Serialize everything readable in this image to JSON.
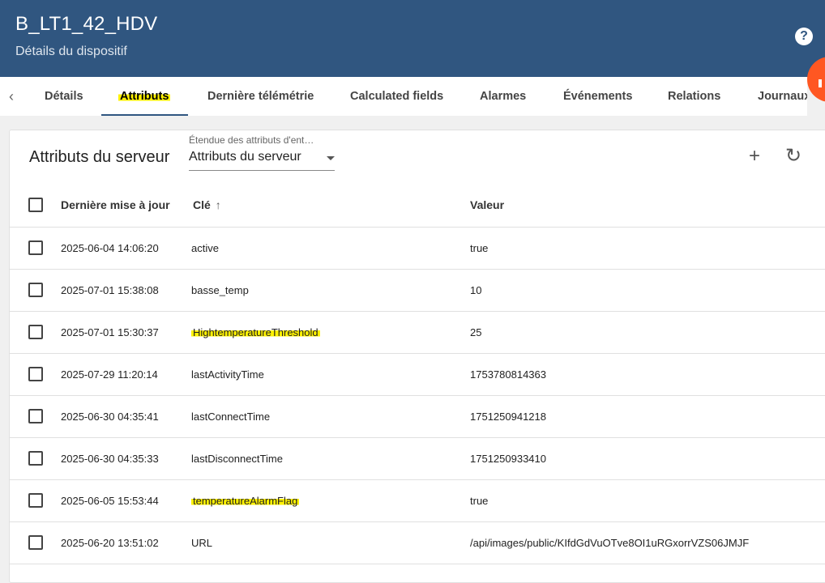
{
  "header": {
    "title": "B_LT1_42_HDV",
    "subtitle": "Détails du dispositif",
    "help_glyph": "?"
  },
  "tabs": [
    {
      "label": "Détails"
    },
    {
      "label": "Attributs",
      "active": true,
      "highlighted": true
    },
    {
      "label": "Dernière télémétrie"
    },
    {
      "label": "Calculated fields"
    },
    {
      "label": "Alarmes"
    },
    {
      "label": "Événements"
    },
    {
      "label": "Relations"
    },
    {
      "label": "Journaux d'audit"
    }
  ],
  "panel": {
    "title": "Attributs du serveur",
    "scope_label": "Étendue des attributs d'ent…",
    "scope_value": "Attributs du serveur",
    "add_glyph": "+",
    "refresh_glyph": "↻"
  },
  "table": {
    "columns": [
      "Dernière mise à jour",
      "Clé",
      "Valeur"
    ],
    "sort_glyph": "↑",
    "rows": [
      {
        "updated": "2025-06-04 14:06:20",
        "key": "active",
        "value": "true"
      },
      {
        "updated": "2025-07-01 15:38:08",
        "key": "basse_temp",
        "value": "10"
      },
      {
        "updated": "2025-07-01 15:30:37",
        "key": "HightemperatureThreshold",
        "value": "25",
        "highlighted": true
      },
      {
        "updated": "2025-07-29 11:20:14",
        "key": "lastActivityTime",
        "value": "1753780814363"
      },
      {
        "updated": "2025-06-30 04:35:41",
        "key": "lastConnectTime",
        "value": "1751250941218"
      },
      {
        "updated": "2025-06-30 04:35:33",
        "key": "lastDisconnectTime",
        "value": "1751250933410"
      },
      {
        "updated": "2025-06-05 15:53:44",
        "key": "temperatureAlarmFlag",
        "value": "true",
        "highlighted": true
      },
      {
        "updated": "2025-06-20 13:51:02",
        "key": "URL",
        "value": "/api/images/public/KIfdGdVuOTve8OI1uRGxorrVZS06JMJF"
      }
    ]
  },
  "colors": {
    "header_bg": "#305680",
    "fab": "#ff5722",
    "highlight": "#fff200"
  },
  "icons": {
    "tab_scroll_left": "chevron-left-icon",
    "help": "help-circle-icon",
    "add": "plus-icon",
    "refresh": "refresh-icon",
    "sort": "arrow-up-icon"
  }
}
